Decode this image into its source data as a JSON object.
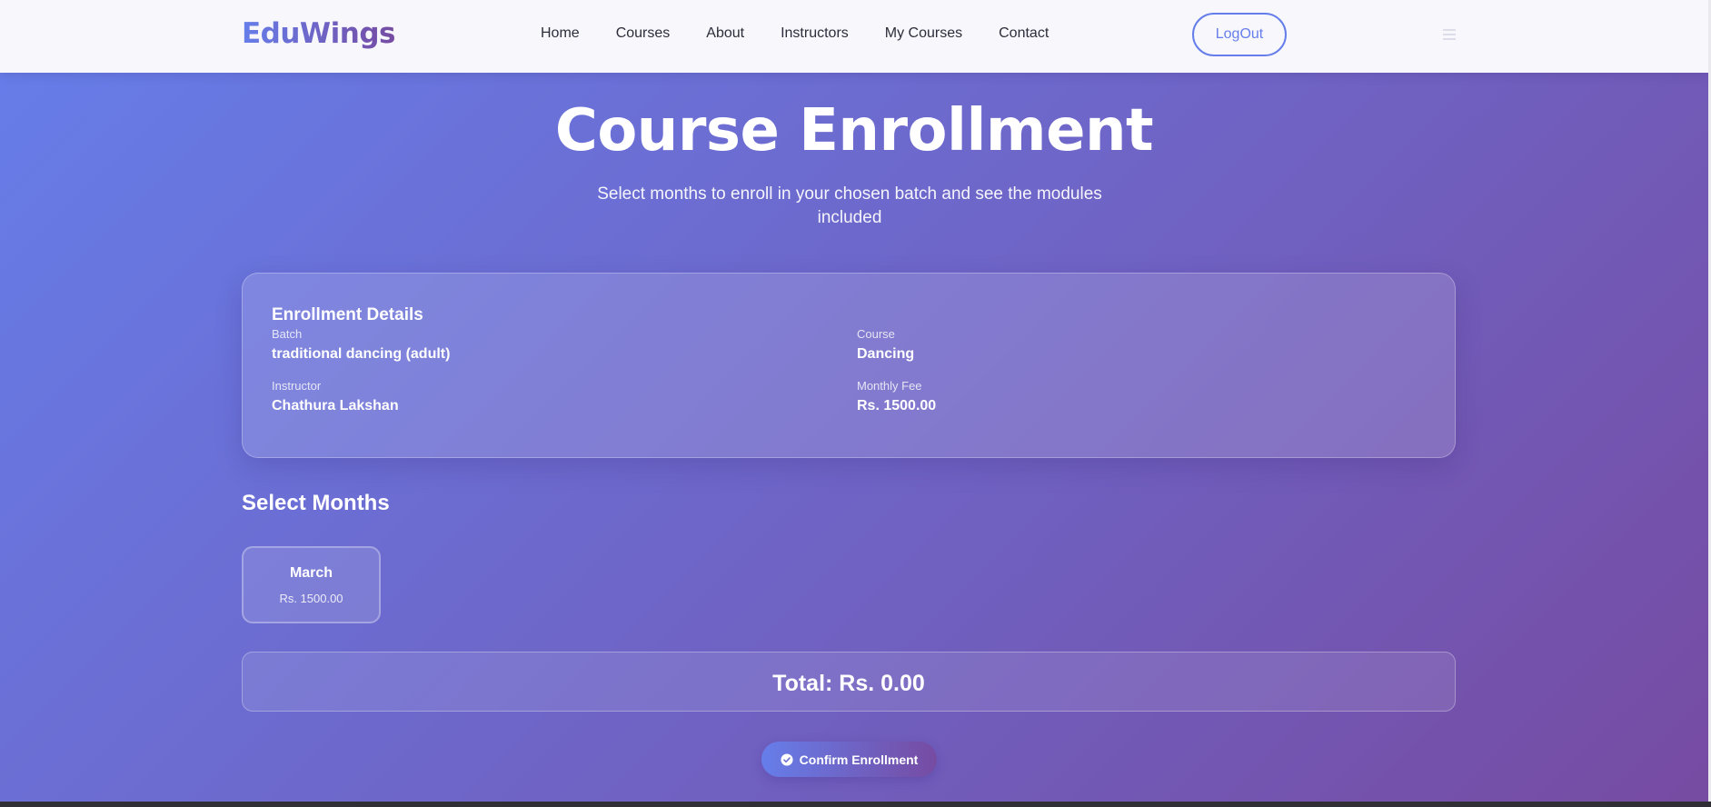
{
  "nav": {
    "logo": "EduWings",
    "links": [
      "Home",
      "Courses",
      "About",
      "Instructors",
      "My Courses",
      "Contact"
    ],
    "logout_label": "LogOut",
    "menu_icon": "hamburger-menu-icon"
  },
  "hero": {
    "title": "Course Enrollment",
    "subtitle": "Select months to enroll in your chosen batch and see the modules included"
  },
  "details": {
    "title": "Enrollment Details",
    "batch_label": "Batch",
    "batch_value": "traditional dancing (adult)",
    "course_label": "Course",
    "course_value": "Dancing",
    "instructor_label": "Instructor",
    "instructor_value": "Chathura Lakshan",
    "fee_label": "Monthly Fee",
    "fee_value": "Rs. 1500.00"
  },
  "months": {
    "title": "Select Months",
    "items": [
      {
        "name": "March",
        "price": "Rs. 1500.00"
      }
    ]
  },
  "total": {
    "text": "Total: Rs. 0.00"
  },
  "confirm": {
    "label": "Confirm Enrollment",
    "icon": "check-circle-icon"
  },
  "colors": {
    "gradient_start": "#667eea",
    "gradient_end": "#764ba2",
    "navbar_bg": "#f7f7fc"
  }
}
